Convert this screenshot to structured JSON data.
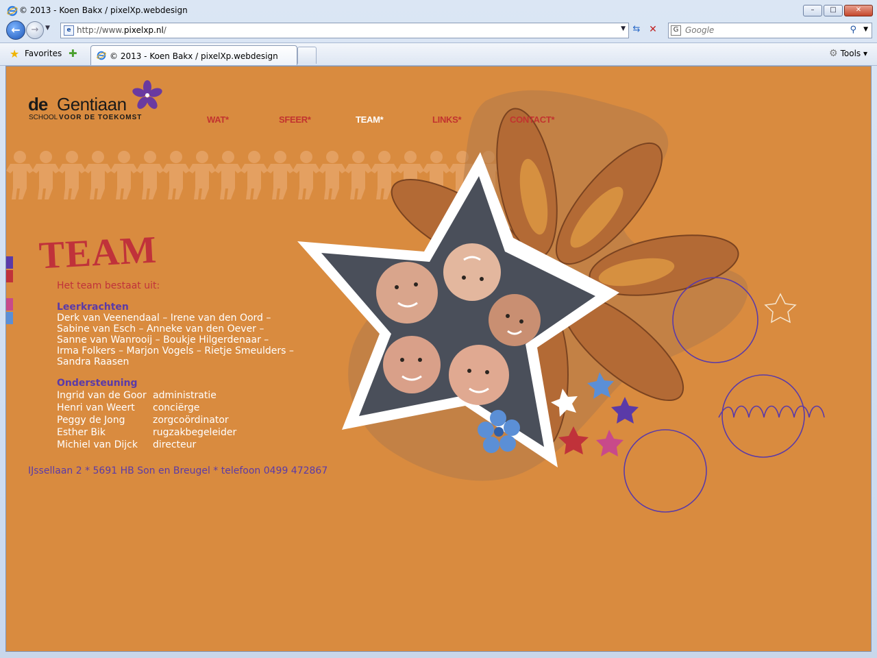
{
  "browser": {
    "window_title": "© 2013 - Koen Bakx / pixelXp.webdesign",
    "url_prefix": "http://www.",
    "url_domain": "pixelxp.nl",
    "url_suffix": "/",
    "search_placeholder": "Google",
    "favorites_label": "Favorites",
    "tab_title": "© 2013 - Koen Bakx / pixelXp.webdesign",
    "tools_label": "Tools",
    "minimize": "–",
    "restore": "□",
    "close": "✕"
  },
  "site": {
    "logo_de": "de",
    "logo_name": "Gentiaan",
    "logo_sub1": "SCHOOL",
    "logo_sub2": "VOOR DE TOEKOMST",
    "nav": [
      {
        "label": "WAT*"
      },
      {
        "label": "SFEER*"
      },
      {
        "label": "TEAM*"
      },
      {
        "label": "LINKS*"
      },
      {
        "label": "CONTACT*"
      }
    ],
    "active_nav": "TEAM*",
    "page_heading": "TEAM",
    "intro": "Het team bestaat uit:",
    "teachers_heading": "Leerkrachten",
    "teachers_lines": [
      "Derk van Veenendaal – Irene van den Oord –",
      "Sabine van Esch – Anneke van den Oever –",
      "Sanne van Wanrooij – Boukje Hilgerdenaar –",
      "Irma Folkers – Marjon Vogels – Rietje Smeulders –",
      "Sandra Raasen"
    ],
    "support_heading": "Ondersteuning",
    "support": [
      {
        "name": "Ingrid van de Goor",
        "role": "administratie"
      },
      {
        "name": "Henri van Weert",
        "role": "conciërge"
      },
      {
        "name": "Peggy de Jong",
        "role": "zorgcoördinator"
      },
      {
        "name": "Esther Bik",
        "role": "rugzakbegeleider"
      },
      {
        "name": "Michiel van Dijck",
        "role": "directeur"
      }
    ],
    "address": "IJssellaan 2 * 5691 HB Son en Breugel * telefoon 0499 472867"
  },
  "colors": {
    "page_bg": "#d98b3f",
    "accent_red": "#c0323a",
    "accent_purple": "#5a3aa8"
  }
}
